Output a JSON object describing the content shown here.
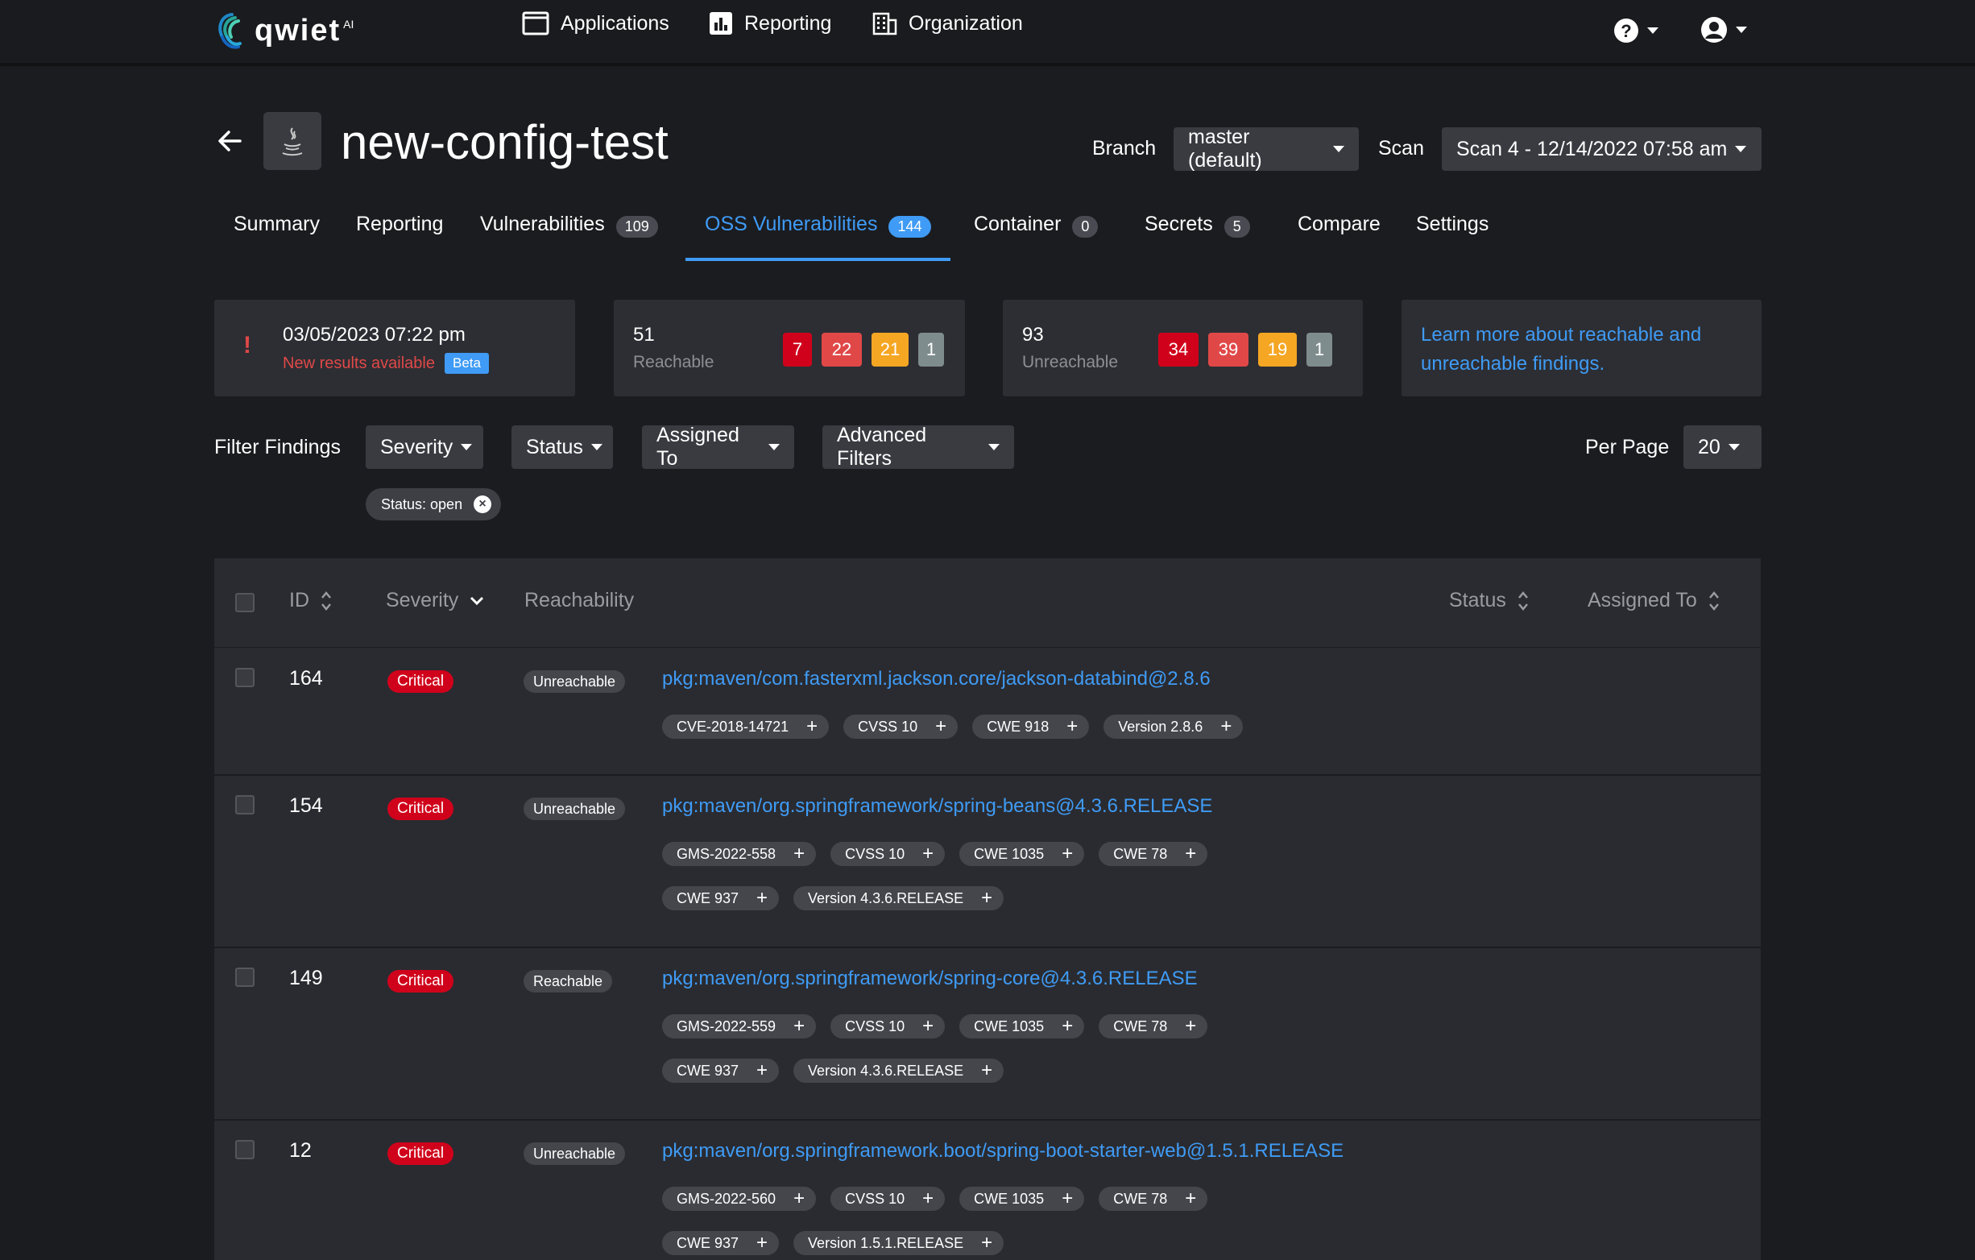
{
  "header": {
    "logo_text": "qwiet",
    "logo_suffix": "AI",
    "nav": [
      {
        "label": "Applications"
      },
      {
        "label": "Reporting"
      },
      {
        "label": "Organization"
      }
    ]
  },
  "page": {
    "title": "new-config-test",
    "branch_label": "Branch",
    "branch_value": "master (default)",
    "scan_label": "Scan",
    "scan_value": "Scan 4 - 12/14/2022 07:58 am"
  },
  "tabs": [
    {
      "label": "Summary",
      "count": null
    },
    {
      "label": "Reporting",
      "count": null
    },
    {
      "label": "Vulnerabilities",
      "count": "109"
    },
    {
      "label": "OSS Vulnerabilities",
      "count": "144",
      "active": true
    },
    {
      "label": "Container",
      "count": "0"
    },
    {
      "label": "Secrets",
      "count": "5"
    },
    {
      "label": "Compare",
      "count": null
    },
    {
      "label": "Settings",
      "count": null
    }
  ],
  "cards": {
    "scan_date": "03/05/2023 07:22 pm",
    "new_results": "New results available",
    "beta": "Beta",
    "reachable": {
      "count": "51",
      "label": "Reachable",
      "critical": "7",
      "high": "22",
      "medium": "21",
      "low": "1"
    },
    "unreachable": {
      "count": "93",
      "label": "Unreachable",
      "critical": "34",
      "high": "39",
      "medium": "19",
      "low": "1"
    },
    "learn_more": "Learn more about reachable and unreachable findings."
  },
  "filters": {
    "label": "Filter Findings",
    "severity": "Severity",
    "status": "Status",
    "assigned_to": "Assigned To",
    "advanced": "Advanced Filters",
    "per_page_label": "Per Page",
    "per_page_value": "20",
    "active_chip": "Status: open"
  },
  "table": {
    "headers": {
      "id": "ID",
      "severity": "Severity",
      "reachability": "Reachability",
      "status": "Status",
      "assigned_to": "Assigned To"
    },
    "rows": [
      {
        "id": "164",
        "severity": "Critical",
        "reachability": "Unreachable",
        "package": "pkg:maven/com.fasterxml.jackson.core/jackson-databind@2.8.6",
        "tags": [
          [
            "CVE-2018-14721",
            "CVSS 10",
            "CWE 918",
            "Version 2.8.6"
          ]
        ]
      },
      {
        "id": "154",
        "severity": "Critical",
        "reachability": "Unreachable",
        "package": "pkg:maven/org.springframework/spring-beans@4.3.6.RELEASE",
        "tags": [
          [
            "GMS-2022-558",
            "CVSS 10",
            "CWE 1035",
            "CWE 78"
          ],
          [
            "CWE 937",
            "Version 4.3.6.RELEASE"
          ]
        ]
      },
      {
        "id": "149",
        "severity": "Critical",
        "reachability": "Reachable",
        "package": "pkg:maven/org.springframework/spring-core@4.3.6.RELEASE",
        "tags": [
          [
            "GMS-2022-559",
            "CVSS 10",
            "CWE 1035",
            "CWE 78"
          ],
          [
            "CWE 937",
            "Version 4.3.6.RELEASE"
          ]
        ]
      },
      {
        "id": "12",
        "severity": "Critical",
        "reachability": "Unreachable",
        "package": "pkg:maven/org.springframework.boot/spring-boot-starter-web@1.5.1.RELEASE",
        "tags": [
          [
            "GMS-2022-560",
            "CVSS 10",
            "CWE 1035",
            "CWE 78"
          ],
          [
            "CWE 937",
            "Version 1.5.1.RELEASE"
          ]
        ]
      }
    ]
  },
  "colors": {
    "accent": "#3f9bf5",
    "critical": "#d0021b",
    "high": "#e04848",
    "medium": "#f5a623",
    "low": "#7f8c8d"
  }
}
